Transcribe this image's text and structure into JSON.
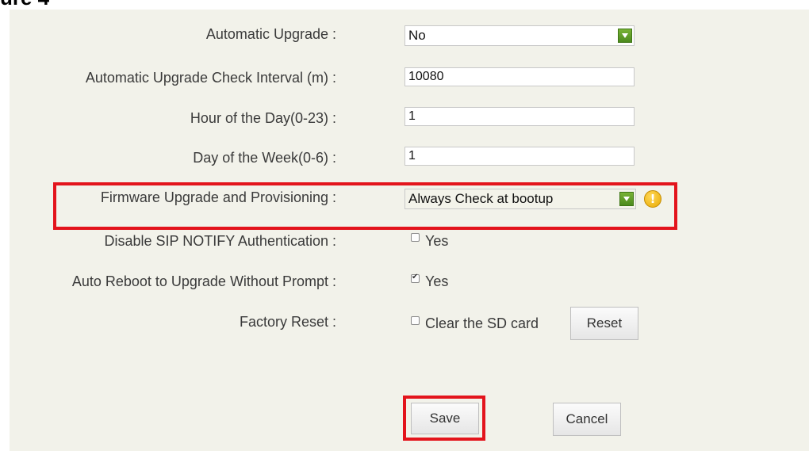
{
  "heading_fragment": "ure 4",
  "fields": {
    "automatic_upgrade": {
      "label": "Automatic Upgrade :",
      "value": "No"
    },
    "check_interval": {
      "label": "Automatic Upgrade Check Interval (m) :",
      "value": "10080"
    },
    "hour_of_day": {
      "label": "Hour of the Day(0-23) :",
      "value": "1"
    },
    "day_of_week": {
      "label": "Day of the Week(0-6) :",
      "value": "1"
    },
    "firmware_provisioning": {
      "label": "Firmware Upgrade and Provisioning :",
      "value": "Always Check at bootup",
      "warning": "!"
    },
    "disable_sip_notify": {
      "label": "Disable SIP NOTIFY Authentication :",
      "option": "Yes",
      "checked": false
    },
    "auto_reboot": {
      "label": "Auto Reboot to Upgrade Without Prompt :",
      "option": "Yes",
      "checked": true
    },
    "factory_reset": {
      "label": "Factory Reset :",
      "option": "Clear the SD card",
      "checked": false,
      "button": "Reset"
    }
  },
  "actions": {
    "save": "Save",
    "cancel": "Cancel"
  },
  "colors": {
    "highlight": "#e3141c",
    "panel": "#f2f2ea",
    "select_arrow": "#5a9a25"
  }
}
